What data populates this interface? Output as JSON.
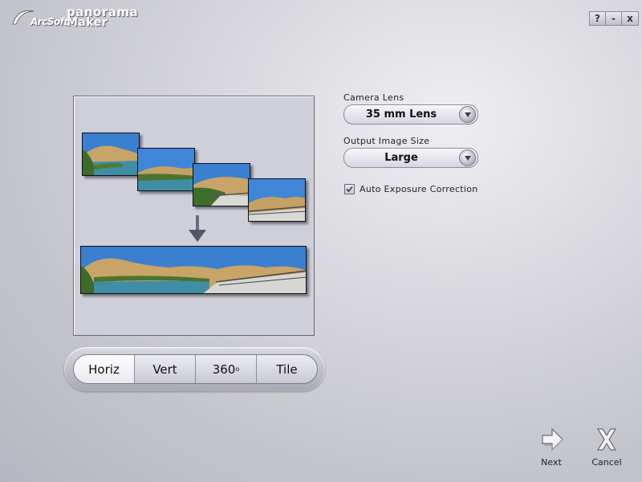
{
  "logo": {
    "brand": "ArcSoft",
    "product_line1": "panorama",
    "product_line2": "Maker"
  },
  "window_controls": {
    "help": "?",
    "minimize": "-",
    "close": "x"
  },
  "settings": {
    "camera_lens_label": "Camera Lens",
    "camera_lens_value": "35 mm Lens",
    "output_size_label": "Output Image Size",
    "output_size_value": "Large",
    "auto_exposure_label": "Auto Exposure Correction",
    "auto_exposure_checked": true
  },
  "modes": [
    {
      "label": "Horiz",
      "active": true
    },
    {
      "label": "Vert",
      "active": false
    },
    {
      "label": "360",
      "sup": "o",
      "active": false
    },
    {
      "label": "Tile",
      "active": false
    }
  ],
  "actions": {
    "next_label": "Next",
    "cancel_label": "Cancel"
  },
  "colors": {
    "sky": "#3a7fd0",
    "hills": "#c8a468",
    "water": "#3f8ea6",
    "trees": "#3e6a2a",
    "accent_dark": "#2e2e3a"
  }
}
